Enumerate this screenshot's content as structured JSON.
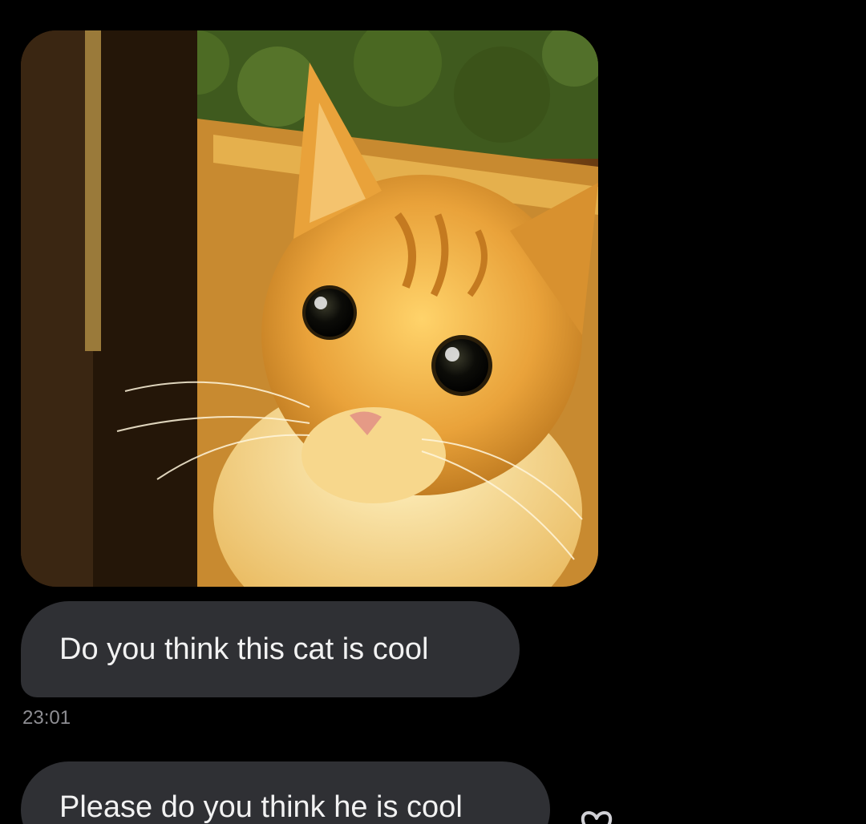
{
  "conversation": {
    "photo": {
      "icon": "kitten-photo",
      "colors": {
        "fur": "#e9a23a",
        "background": "#3b2410",
        "foliage": "#3f5a1e"
      }
    },
    "messages": [
      {
        "text": "Do you think this cat is cool"
      },
      {
        "text": "Please do you think he is cool"
      }
    ],
    "timestamp": "23:01",
    "reaction_icon": "heart-outline-icon"
  },
  "colors": {
    "background": "#000000",
    "bubble": "#2f3034",
    "bubble_text": "#f2f2f2",
    "timestamp": "#8e8e93"
  }
}
